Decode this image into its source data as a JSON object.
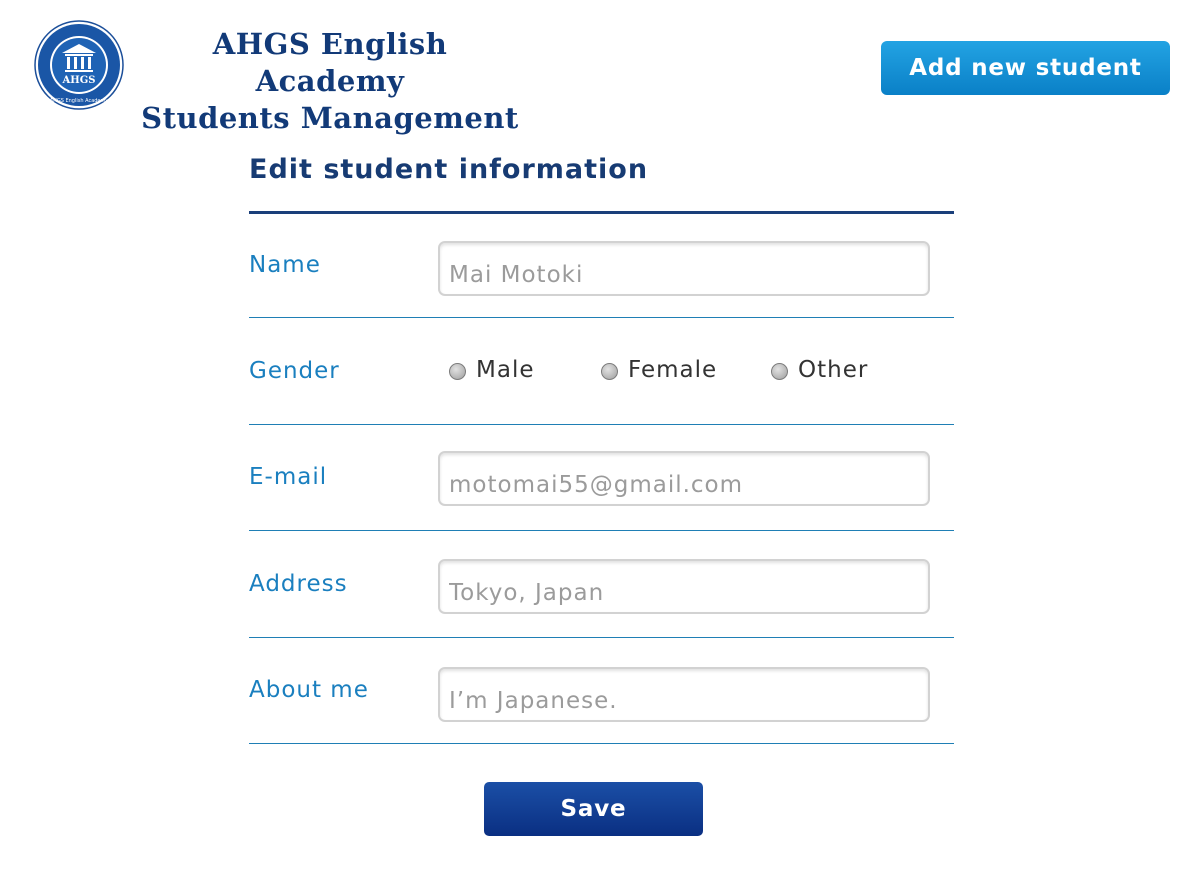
{
  "header": {
    "brand_line1": "AHGS English Academy",
    "brand_line2": "Students Management",
    "add_button_label": "Add new student",
    "logo": {
      "icon": "academy-seal",
      "seal_text": "AHGS",
      "ring_text": "AHGS English Academy"
    }
  },
  "form": {
    "title": "Edit student information",
    "name": {
      "label": "Name",
      "value": "Mai Motoki"
    },
    "gender": {
      "label": "Gender",
      "options": [
        "Male",
        "Female",
        "Other"
      ]
    },
    "email": {
      "label": "E-mail",
      "value": "motomai55@gmail.com"
    },
    "address": {
      "label": "Address",
      "value": "Tokyo, Japan"
    },
    "about": {
      "label": "About me",
      "value": "I’m Japanese."
    },
    "save_label": "Save"
  },
  "colors": {
    "brand_navy": "#123a78",
    "label_blue": "#1a7fbf",
    "add_button": "#1592d6",
    "save_button": "#0d358c"
  }
}
